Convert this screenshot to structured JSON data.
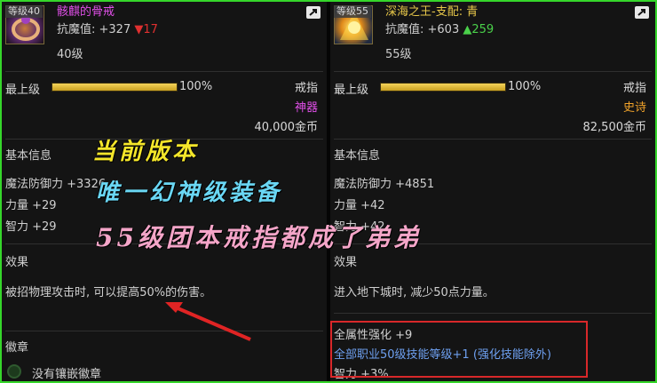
{
  "left": {
    "level_tag": "等级40",
    "name": "骸麒的骨戒",
    "stat_label": "抗魔值: +327",
    "stat_delta": "▼17",
    "level": "40级",
    "max_level_label": "最上级",
    "max_level_pct": "100%",
    "max_level_fill": 1.0,
    "slot": "戒指",
    "rarity": "神器",
    "price": "40,000金币",
    "basic_info_label": "基本信息",
    "stats": [
      "魔法防御力 +3326",
      "力量 +29",
      "智力 +29"
    ],
    "effect_label": "效果",
    "effect_text": "被招物理攻击时, 可以提高50%的伤害。",
    "emblem_label": "徽章",
    "emblem_text": "没有镶嵌徽章"
  },
  "right": {
    "level_tag": "等级55",
    "name": "深海之王-支配: 青",
    "stat_label": "抗魔值: +603",
    "stat_delta": "▲259",
    "level": "55级",
    "max_level_label": "最上级",
    "max_level_pct": "100%",
    "max_level_fill": 1.0,
    "slot": "戒指",
    "rarity": "史诗",
    "price": "82,500金币",
    "basic_info_label": "基本信息",
    "stats": [
      "魔法防御力 +4851",
      "力量 +42",
      "智力 +42"
    ],
    "effect_label": "效果",
    "effect_text": "进入地下城时, 减少50点力量。",
    "bonus": [
      "全属性强化 +9",
      "全部职业50级技能等级+1 (强化技能除外)",
      "智力 +3%"
    ]
  },
  "overlay": {
    "line1": "当前版本",
    "line2": "唯一幻神级装备",
    "line3": "55级团本戒指都成了弟弟"
  },
  "colors": {
    "frame": "#35d62a",
    "highlight_box": "#d8282a",
    "epic": "#f0a22a",
    "artifact": "#e04fe8"
  }
}
